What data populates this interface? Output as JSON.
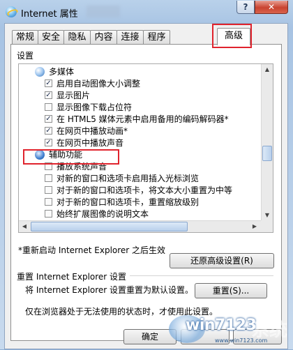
{
  "window": {
    "title": "Internet 属性",
    "help_label": "?",
    "close_label": "✕"
  },
  "tabs": [
    {
      "label": "常规"
    },
    {
      "label": "安全"
    },
    {
      "label": "隐私"
    },
    {
      "label": "内容"
    },
    {
      "label": "连接"
    },
    {
      "label": "程序"
    },
    {
      "label": "高级",
      "active": true
    }
  ],
  "settings": {
    "section_label": "设置",
    "tree": [
      {
        "type": "group",
        "icon": "multimedia-icon",
        "label": "多媒体"
      },
      {
        "type": "item",
        "checked": true,
        "label": "启用自动图像大小调整"
      },
      {
        "type": "item",
        "checked": true,
        "label": "显示图片"
      },
      {
        "type": "item",
        "checked": false,
        "label": "显示图像下载占位符"
      },
      {
        "type": "item",
        "checked": true,
        "label": "在 HTML5 媒体元素中启用备用的编码解码器*"
      },
      {
        "type": "item",
        "checked": true,
        "label": "在网页中播放动画*"
      },
      {
        "type": "item",
        "checked": true,
        "label": "在网页中播放声音",
        "highlighted": true
      },
      {
        "type": "group",
        "icon": "accessibility-icon",
        "label": "辅助功能"
      },
      {
        "type": "item",
        "checked": false,
        "label": "播放系统声音"
      },
      {
        "type": "item",
        "checked": false,
        "label": "对新的窗口和选项卡启用插入光标浏览"
      },
      {
        "type": "item",
        "checked": false,
        "label": "对于新的窗口和选项卡，将文本大小重置为中等"
      },
      {
        "type": "item",
        "checked": false,
        "label": "对于新的窗口和选项卡，重置缩放级别"
      },
      {
        "type": "item",
        "checked": false,
        "label": "始终扩展图像的说明文本"
      }
    ]
  },
  "note": "*重新启动 Internet Explorer 之后生效",
  "restore_button": "还原高级设置(R)",
  "reset": {
    "section_label": "重置 Internet Explorer 设置",
    "description": "将 Internet Explorer 设置重置为默认设置。",
    "button": "重置(S)...",
    "hint": "仅在浏览器处于无法使用的状态时，才使用此设置。"
  },
  "footer": {
    "ok": "确定",
    "cancel": "",
    "apply": ""
  },
  "watermark": {
    "text": "win7123",
    "suffix": "系统",
    "url": "www.win7123.com"
  },
  "colors": {
    "highlight_box": "#e0232d",
    "title_gradient_top": "#b9d1ea"
  }
}
